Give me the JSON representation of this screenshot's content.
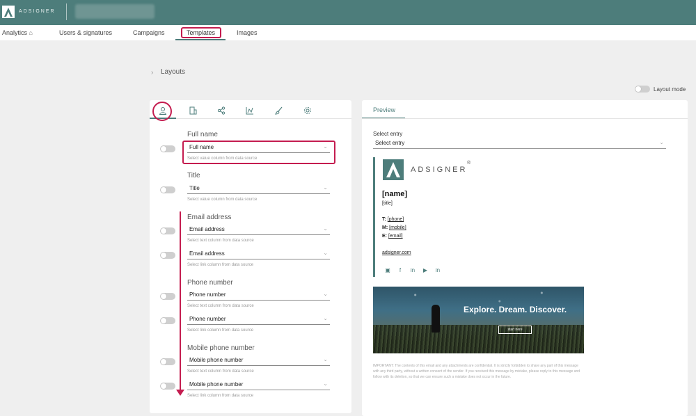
{
  "topbar": {
    "brand": "ADSIGNER",
    "colors": {
      "header": "#4d7d7b",
      "highlight": "#c41c4f"
    }
  },
  "nav": {
    "items": [
      {
        "label": "Analytics",
        "icon": "home-icon"
      },
      {
        "label": "Users & signatures"
      },
      {
        "label": "Campaigns"
      },
      {
        "label": "Templates",
        "active": true
      },
      {
        "label": "Images"
      }
    ]
  },
  "breadcrumb": "Layouts",
  "layout_mode_label": "Layout mode",
  "editor": {
    "tabs": [
      "user-icon",
      "building-icon",
      "share-icon",
      "chart-icon",
      "brush-icon",
      "gear-icon"
    ],
    "fields": [
      {
        "title": "Full name",
        "rows": [
          {
            "value": "Full name",
            "helper": "Select value column from data source"
          }
        ]
      },
      {
        "title": "Title",
        "rows": [
          {
            "value": "Title",
            "helper": "Select value column from data source"
          }
        ]
      },
      {
        "title": "Email address",
        "rows": [
          {
            "value": "Email address",
            "helper": "Select text column from data source"
          },
          {
            "value": "Email address",
            "helper": "Select link column from data source"
          }
        ]
      },
      {
        "title": "Phone number",
        "rows": [
          {
            "value": "Phone number",
            "helper": "Select text column from data source"
          },
          {
            "value": "Phone number",
            "helper": "Select link column from data source"
          }
        ]
      },
      {
        "title": "Mobile phone number",
        "rows": [
          {
            "value": "Mobile phone number",
            "helper": "Select text column from data source"
          },
          {
            "value": "Mobile phone number",
            "helper": "Select link column from data source"
          }
        ]
      }
    ]
  },
  "preview": {
    "tab_label": "Preview",
    "select_label": "Select entry",
    "select_value": "Select entry",
    "signature": {
      "brand": "ADSIGNER",
      "reg": "®",
      "name": "[name]",
      "title": "[title]",
      "phone_prefix": "T:",
      "phone": "[phone]",
      "mobile_prefix": "M:",
      "mobile": "[mobile]",
      "email_prefix": "E:",
      "email": "[email]",
      "website": "adsigner.com",
      "social_icons": [
        "instagram-icon",
        "facebook-icon",
        "linkedin-icon",
        "youtube-icon",
        "linkedin-icon"
      ]
    },
    "banner": {
      "headline": "Explore. Dream. Discover.",
      "button": "start here"
    },
    "disclaimer": "IMPORTANT: The contents of this email and any attachments are confidential. It is strictly forbidden to share any part of this message with any third party, without a written consent of the sender. If you received this message by mistake, please reply to this message and follow with its deletion, so that we can ensure such a mistake does not occur in the future."
  }
}
